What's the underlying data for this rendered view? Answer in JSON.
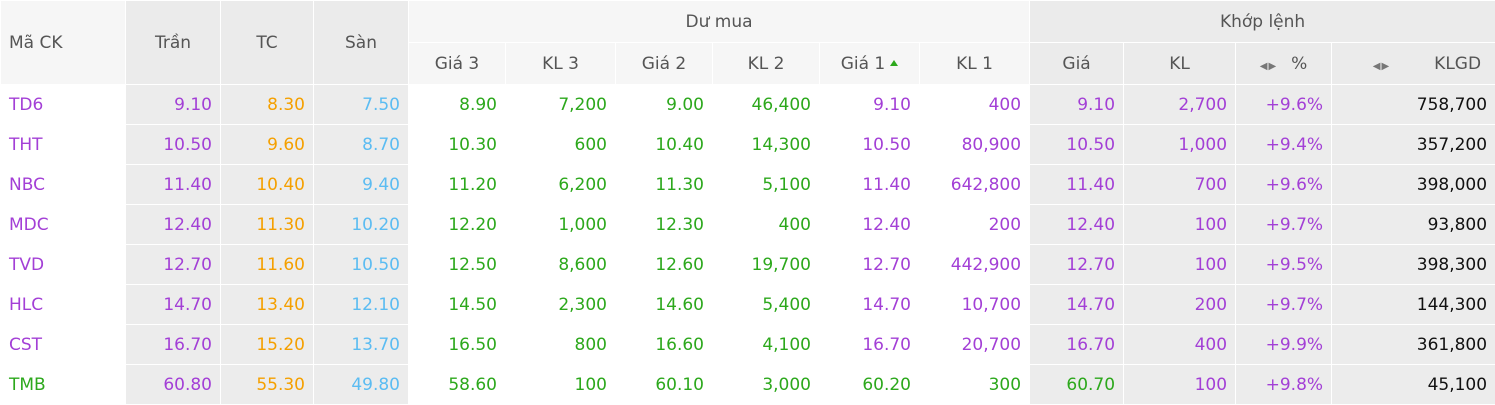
{
  "headers": {
    "ma_ck": "Mã CK",
    "tran": "Trần",
    "tc": "TC",
    "san": "Sàn",
    "du_mua": "Dư mua",
    "khop_lenh": "Khớp lệnh",
    "gia3": "Giá 3",
    "kl3": "KL 3",
    "gia2": "Giá 2",
    "kl2": "KL 2",
    "gia1": "Giá 1",
    "kl1": "KL 1",
    "gia": "Giá",
    "kl": "KL",
    "pct": "%",
    "klgd": "KLGD"
  },
  "colors": {
    "ceiling": "#a33fd6",
    "reference": "#f5a000",
    "floor": "#5bbcf2",
    "up": "#2ca81c"
  },
  "rows": [
    {
      "ma": "TD6",
      "tran": "9.10",
      "tc": "8.30",
      "san": "7.50",
      "gia3": "8.90",
      "kl3": "7,200",
      "gia2": "9.00",
      "kl2": "46,400",
      "gia1": "9.10",
      "kl1": "400",
      "gia": "9.10",
      "kl": "2,700",
      "pct": "+9.6%",
      "klgd": "758,700"
    },
    {
      "ma": "THT",
      "tran": "10.50",
      "tc": "9.60",
      "san": "8.70",
      "gia3": "10.30",
      "kl3": "600",
      "gia2": "10.40",
      "kl2": "14,300",
      "gia1": "10.50",
      "kl1": "80,900",
      "gia": "10.50",
      "kl": "1,000",
      "pct": "+9.4%",
      "klgd": "357,200"
    },
    {
      "ma": "NBC",
      "tran": "11.40",
      "tc": "10.40",
      "san": "9.40",
      "gia3": "11.20",
      "kl3": "6,200",
      "gia2": "11.30",
      "kl2": "5,100",
      "gia1": "11.40",
      "kl1": "642,800",
      "gia": "11.40",
      "kl": "700",
      "pct": "+9.6%",
      "klgd": "398,000"
    },
    {
      "ma": "MDC",
      "tran": "12.40",
      "tc": "11.30",
      "san": "10.20",
      "gia3": "12.20",
      "kl3": "1,000",
      "gia2": "12.30",
      "kl2": "400",
      "gia1": "12.40",
      "kl1": "200",
      "gia": "12.40",
      "kl": "100",
      "pct": "+9.7%",
      "klgd": "93,800"
    },
    {
      "ma": "TVD",
      "tran": "12.70",
      "tc": "11.60",
      "san": "10.50",
      "gia3": "12.50",
      "kl3": "8,600",
      "gia2": "12.60",
      "kl2": "19,700",
      "gia1": "12.70",
      "kl1": "442,900",
      "gia": "12.70",
      "kl": "100",
      "pct": "+9.5%",
      "klgd": "398,300"
    },
    {
      "ma": "HLC",
      "tran": "14.70",
      "tc": "13.40",
      "san": "12.10",
      "gia3": "14.50",
      "kl3": "2,300",
      "gia2": "14.60",
      "kl2": "5,400",
      "gia1": "14.70",
      "kl1": "10,700",
      "gia": "14.70",
      "kl": "200",
      "pct": "+9.7%",
      "klgd": "144,300"
    },
    {
      "ma": "CST",
      "tran": "16.70",
      "tc": "15.20",
      "san": "13.70",
      "gia3": "16.50",
      "kl3": "800",
      "gia2": "16.60",
      "kl2": "4,100",
      "gia1": "16.70",
      "kl1": "20,700",
      "gia": "16.70",
      "kl": "400",
      "pct": "+9.9%",
      "klgd": "361,800"
    },
    {
      "ma": "TMB",
      "tran": "60.80",
      "tc": "55.30",
      "san": "49.80",
      "gia3": "58.60",
      "kl3": "100",
      "gia2": "60.10",
      "kl2": "3,000",
      "gia1": "60.20",
      "kl1": "300",
      "gia": "60.70",
      "kl": "100",
      "pct": "+9.8%",
      "klgd": "45,100"
    }
  ]
}
